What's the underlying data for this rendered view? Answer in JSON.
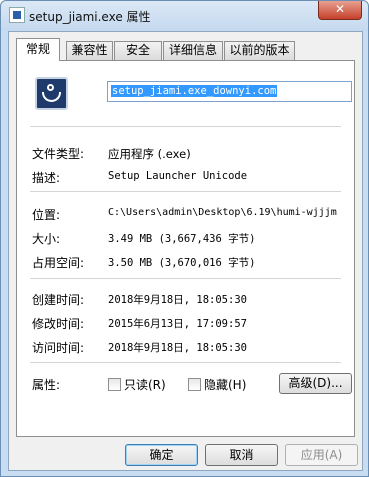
{
  "window": {
    "title": "setup_jiami.exe 属性",
    "close": "✕"
  },
  "tabs": [
    "常规",
    "兼容性",
    "安全",
    "详细信息",
    "以前的版本"
  ],
  "general": {
    "filename": "setup_jiami.exe_downyi.com",
    "type_label": "文件类型:",
    "type_value": "应用程序 (.exe)",
    "desc_label": "描述:",
    "desc_value": "Setup Launcher Unicode",
    "location_label": "位置:",
    "location_value": "C:\\Users\\admin\\Desktop\\6.19\\humi-wjjjm",
    "size_label": "大小:",
    "size_value": "3.49 MB (3,667,436 字节)",
    "disk_label": "占用空间:",
    "disk_value": "3.50 MB (3,670,016 字节)",
    "created_label": "创建时间:",
    "created_value": "2018年9月18日, 18:05:30",
    "modified_label": "修改时间:",
    "modified_value": "2015年6月13日, 17:09:57",
    "accessed_label": "访问时间:",
    "accessed_value": "2018年9月18日, 18:05:30",
    "attributes_label": "属性:",
    "readonly_label": "只读(R)",
    "hidden_label": "隐藏(H)",
    "advanced_label": "高级(D)..."
  },
  "buttons": {
    "ok": "确定",
    "cancel": "取消",
    "apply": "应用(A)"
  }
}
